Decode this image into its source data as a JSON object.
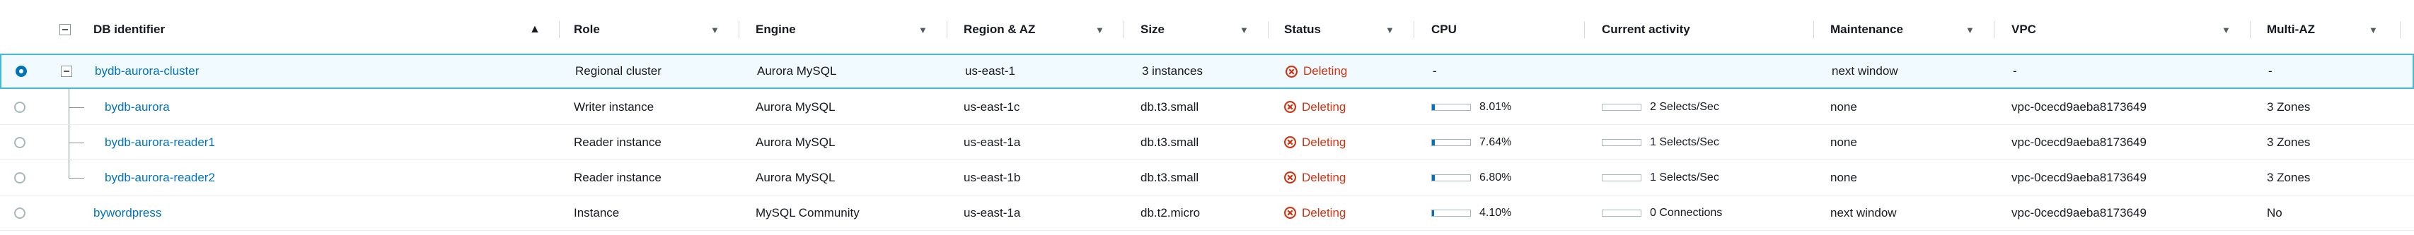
{
  "header": {
    "db_identifier": "DB identifier",
    "role": "Role",
    "engine": "Engine",
    "region_az": "Region & AZ",
    "size": "Size",
    "status": "Status",
    "cpu": "CPU",
    "current_activity": "Current activity",
    "maintenance": "Maintenance",
    "vpc": "VPC",
    "multi_az": "Multi-AZ"
  },
  "rows": [
    {
      "db_identifier": "bydb-aurora-cluster",
      "role": "Regional cluster",
      "engine": "Aurora MySQL",
      "region_az": "us-east-1",
      "size": "3 instances",
      "status": "Deleting",
      "cpu": "-",
      "current_activity": "",
      "maintenance": "next window",
      "vpc": "-",
      "multi_az": "-",
      "selected": true
    },
    {
      "db_identifier": "bydb-aurora",
      "role": "Writer instance",
      "engine": "Aurora MySQL",
      "region_az": "us-east-1c",
      "size": "db.t3.small",
      "status": "Deleting",
      "cpu": "8.01%",
      "cpu_fraction": 0.0801,
      "current_activity": "2 Selects/Sec",
      "maintenance": "none",
      "vpc": "vpc-0cecd9aeba8173649",
      "multi_az": "3 Zones"
    },
    {
      "db_identifier": "bydb-aurora-reader1",
      "role": "Reader instance",
      "engine": "Aurora MySQL",
      "region_az": "us-east-1a",
      "size": "db.t3.small",
      "status": "Deleting",
      "cpu": "7.64%",
      "cpu_fraction": 0.0764,
      "current_activity": "1 Selects/Sec",
      "maintenance": "none",
      "vpc": "vpc-0cecd9aeba8173649",
      "multi_az": "3 Zones"
    },
    {
      "db_identifier": "bydb-aurora-reader2",
      "role": "Reader instance",
      "engine": "Aurora MySQL",
      "region_az": "us-east-1b",
      "size": "db.t3.small",
      "status": "Deleting",
      "cpu": "6.80%",
      "cpu_fraction": 0.068,
      "current_activity": "1 Selects/Sec",
      "maintenance": "none",
      "vpc": "vpc-0cecd9aeba8173649",
      "multi_az": "3 Zones"
    },
    {
      "db_identifier": "bywordpress",
      "role": "Instance",
      "engine": "MySQL Community",
      "region_az": "us-east-1a",
      "size": "db.t2.micro",
      "status": "Deleting",
      "cpu": "4.10%",
      "cpu_fraction": 0.041,
      "current_activity": "0 Connections",
      "maintenance": "next window",
      "vpc": "vpc-0cecd9aeba8173649",
      "multi_az": "No"
    }
  ],
  "icons": {
    "status_icon": "x-circle-icon",
    "sort_active": "sort-ascending-icon",
    "sort_inactive": "sort-descending-icon"
  },
  "colors": {
    "link": "#0073bb",
    "deleting": "#d13212",
    "selected_border": "#44b9d6",
    "selected_bg": "#f1faff"
  }
}
